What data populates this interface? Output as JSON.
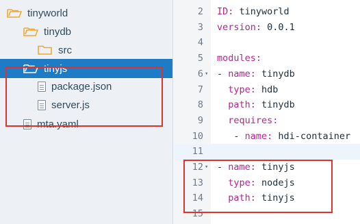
{
  "file_tree": [
    {
      "label": "tinyworld",
      "type": "folder",
      "icon": "folder-open-icon",
      "indent": 0,
      "selected": false
    },
    {
      "label": "tinydb",
      "type": "folder",
      "icon": "folder-open-icon",
      "indent": 1,
      "selected": false
    },
    {
      "label": "src",
      "type": "folder",
      "icon": "folder-icon",
      "indent": 2,
      "selected": false
    },
    {
      "label": "tinyjs",
      "type": "folder",
      "icon": "folder-open-icon",
      "indent": 1,
      "selected": true
    },
    {
      "label": "package.json",
      "type": "file",
      "icon": "file-icon",
      "indent": 2,
      "selected": false
    },
    {
      "label": "server.js",
      "type": "file",
      "icon": "file-icon",
      "indent": 2,
      "selected": false
    },
    {
      "label": "mta.yaml",
      "type": "file",
      "icon": "file-icon",
      "indent": 1,
      "selected": false
    }
  ],
  "editor": {
    "lines": [
      {
        "num": "2",
        "fold": "",
        "indent": "",
        "dash": "",
        "key": "ID:",
        "value": " tinyworld"
      },
      {
        "num": "3",
        "fold": "",
        "indent": "",
        "dash": "",
        "key": "version:",
        "value": " 0.0.1"
      },
      {
        "num": "4",
        "fold": "",
        "indent": "",
        "dash": "",
        "key": "",
        "value": ""
      },
      {
        "num": "5",
        "fold": "",
        "indent": "",
        "dash": "",
        "key": "modules:",
        "value": ""
      },
      {
        "num": "6",
        "fold": "▾",
        "indent": "",
        "dash": "- ",
        "key": "name:",
        "value": " tinydb"
      },
      {
        "num": "7",
        "fold": "",
        "indent": "  ",
        "dash": "",
        "key": "type:",
        "value": " hdb"
      },
      {
        "num": "8",
        "fold": "",
        "indent": "  ",
        "dash": "",
        "key": "path:",
        "value": " tinydb"
      },
      {
        "num": "9",
        "fold": "",
        "indent": "  ",
        "dash": "",
        "key": "requires:",
        "value": ""
      },
      {
        "num": "10",
        "fold": "",
        "indent": "   ",
        "dash": "- ",
        "key": "name:",
        "value": " hdi-container"
      },
      {
        "num": "11",
        "fold": "",
        "indent": "",
        "dash": "",
        "key": "",
        "value": ""
      },
      {
        "num": "12",
        "fold": "▾",
        "indent": "",
        "dash": "- ",
        "key": "name:",
        "value": " tinyjs"
      },
      {
        "num": "13",
        "fold": "",
        "indent": "  ",
        "dash": "",
        "key": "type:",
        "value": " nodejs"
      },
      {
        "num": "14",
        "fold": "",
        "indent": "  ",
        "dash": "",
        "key": "path:",
        "value": " tinyjs"
      },
      {
        "num": "15",
        "fold": "",
        "indent": "",
        "dash": "",
        "key": "",
        "value": ""
      }
    ]
  },
  "colors": {
    "selection": "#1e7bc5",
    "highlight_box": "#e0322c",
    "yaml_key": "#b5248f",
    "folder": "#f0a830"
  }
}
